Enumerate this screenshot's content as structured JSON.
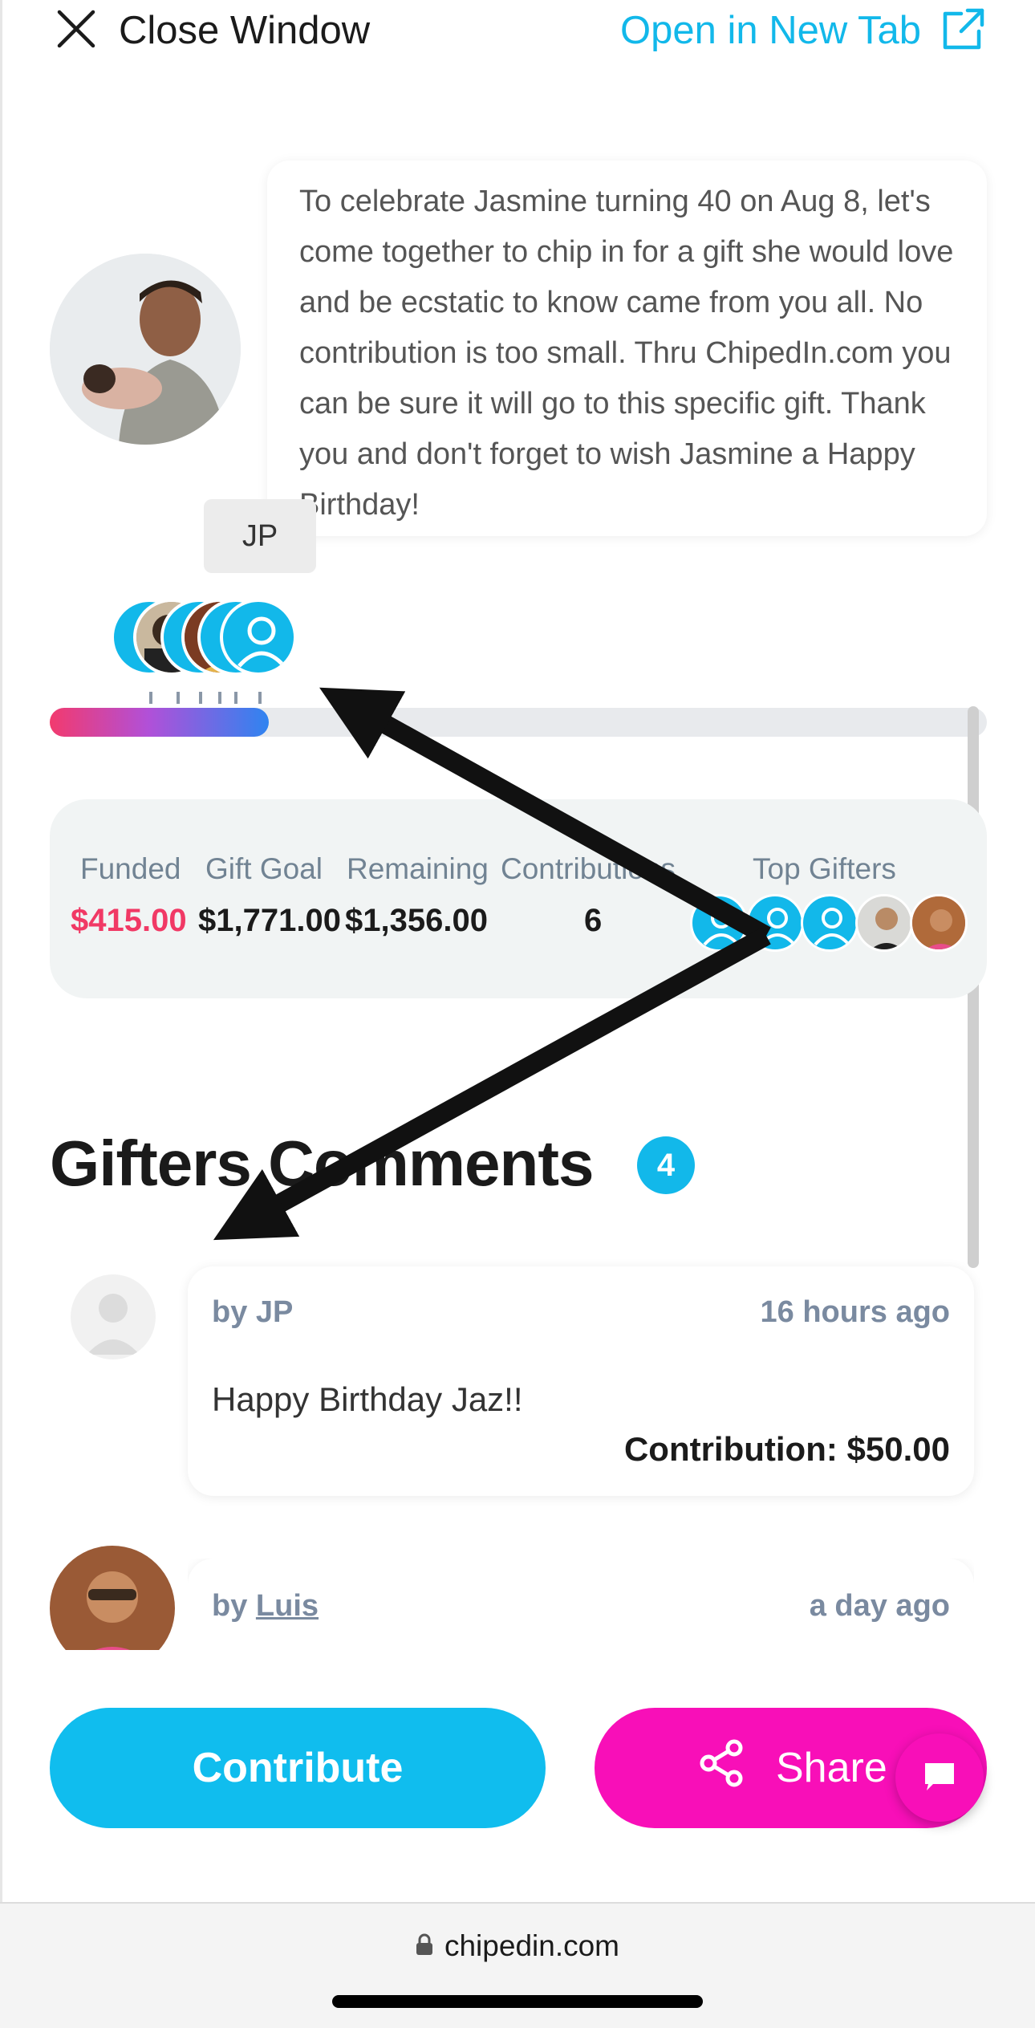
{
  "header": {
    "close_label": "Close Window",
    "open_tab_label": "Open in New Tab"
  },
  "message": {
    "text": "To celebrate Jasmine turning 40 on Aug 8, let's come together to chip in for a gift she would love and be ecstatic to know came from you all. No contribution is too small. Thru ChipedIn.com you can be sure it will go to this specific gift. Thank you and don't forget to wish Jasmine a Happy Birthday!"
  },
  "tooltip": {
    "text": "JP"
  },
  "progress": {
    "fraction": 0.234
  },
  "stats": {
    "funded_label": "Funded",
    "funded_value": "$415.00",
    "goal_label": "Gift Goal",
    "goal_value": "$1,771.00",
    "remaining_label": "Remaining",
    "remaining_value": "$1,356.00",
    "contributions_label": "Contributions",
    "contributions_value": "6",
    "top_gifters_label": "Top Gifters"
  },
  "comments": {
    "title": "Gifters Comments",
    "count": "4",
    "items": [
      {
        "author": "by JP",
        "time": "16 hours ago",
        "text": "Happy Birthday Jaz!!",
        "contribution": "Contribution: $50.00"
      },
      {
        "author_prefix": "by ",
        "author_name": "Luis",
        "time": "a day ago"
      }
    ]
  },
  "actions": {
    "contribute_label": "Contribute",
    "share_label": "Share"
  },
  "browser": {
    "url": "chipedin.com"
  },
  "colors": {
    "accent_blue": "#12b8ea",
    "funded_red": "#f13965",
    "share_pink": "#f80fb8",
    "muted_text": "#7a8aa0"
  }
}
